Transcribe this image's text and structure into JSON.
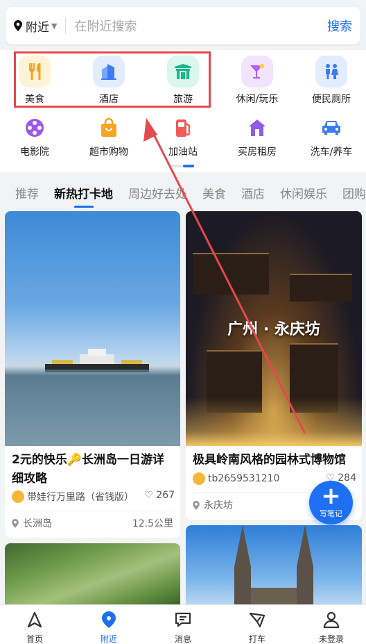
{
  "search": {
    "location": "附近",
    "placeholder": "在附近搜索",
    "button": "搜索"
  },
  "categories": [
    {
      "label": "美食",
      "icon": "fork-knife-icon",
      "color": "#f7a21c",
      "bg": "#fff3d6"
    },
    {
      "label": "酒店",
      "icon": "building-icon",
      "color": "#3d7bf2",
      "bg": "#e2ecff"
    },
    {
      "label": "旅游",
      "icon": "gate-icon",
      "color": "#17b889",
      "bg": "#d9f7ec"
    },
    {
      "label": "休闲/玩乐",
      "icon": "cocktail-icon",
      "color": "#b35ff2",
      "bg": "#f2e4ff"
    },
    {
      "label": "便民厕所",
      "icon": "restroom-icon",
      "color": "#3d7bf2",
      "bg": "#e2ecff"
    },
    {
      "label": "电影院",
      "icon": "film-reel-icon",
      "color": "#9b59e8"
    },
    {
      "label": "超市购物",
      "icon": "shopping-bag-icon",
      "color": "#f5a623"
    },
    {
      "label": "加油站",
      "icon": "gas-pump-icon",
      "color": "#f05a5a"
    },
    {
      "label": "买房租房",
      "icon": "house-icon",
      "color": "#8e5ce8"
    },
    {
      "label": "洗车/养车",
      "icon": "car-icon",
      "color": "#3d7bf2"
    }
  ],
  "tabs": [
    "推荐",
    "新热打卡地",
    "周边好去处",
    "美食",
    "酒店",
    "休闲娱乐",
    "团购"
  ],
  "active_tab": "新热打卡地",
  "cards": [
    {
      "title": "2元的快乐🔑长洲岛一日游详细攻略",
      "author": "带娃行万里路（省钱版）",
      "likes": "267",
      "place": "长洲岛",
      "distance": "12.5公里"
    },
    {
      "overlay": "广州 · 永庆坊",
      "title": "极具岭南风格的园林式博物馆",
      "author": "tb2659531210",
      "likes": "284",
      "place": "永庆坊"
    }
  ],
  "fab": {
    "label": "写笔记"
  },
  "bottom_nav": [
    {
      "label": "首页",
      "icon": "home-triangle-icon"
    },
    {
      "label": "附近",
      "icon": "location-pin-icon"
    },
    {
      "label": "消息",
      "icon": "message-icon"
    },
    {
      "label": "打车",
      "icon": "taxi-icon"
    },
    {
      "label": "未登录",
      "icon": "user-icon"
    }
  ],
  "colors": {
    "accent": "#1e6ff2",
    "highlight": "#e5484d"
  }
}
